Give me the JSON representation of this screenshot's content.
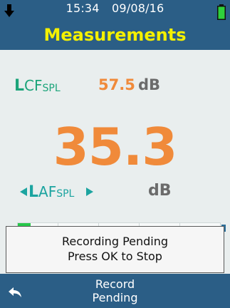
{
  "status_bar": {
    "time": "15:34",
    "date": "09/08/16",
    "battery_color": "#2fd13b"
  },
  "header": {
    "title": "Measurements"
  },
  "readings": {
    "lcf": {
      "main": "L",
      "mid": "CF",
      "sub": "SPL",
      "value": "57.5",
      "unit": "dB"
    },
    "primary": {
      "value": "35.3",
      "main": "L",
      "mid": "AF",
      "sub": "SPL",
      "unit": "dB"
    }
  },
  "dialog": {
    "line1": "Recording Pending",
    "line2": "Press OK to Stop"
  },
  "footer": {
    "line1": "Record",
    "line2": "Pending"
  },
  "colors": {
    "header_bg": "#2b5e86",
    "title": "#f4f000",
    "accent_orange": "#f08a3a",
    "accent_green": "#1ca47a",
    "accent_teal": "#1ca4a0",
    "unit_gray": "#6b6b6b",
    "body_bg": "#e9eeee"
  },
  "icons": {
    "top_left": "down-arrow-icon",
    "top_right": "battery-icon",
    "footer_left": "back-arrow-icon",
    "laf_left": "left-triangle-icon",
    "laf_right": "right-triangle-icon"
  }
}
